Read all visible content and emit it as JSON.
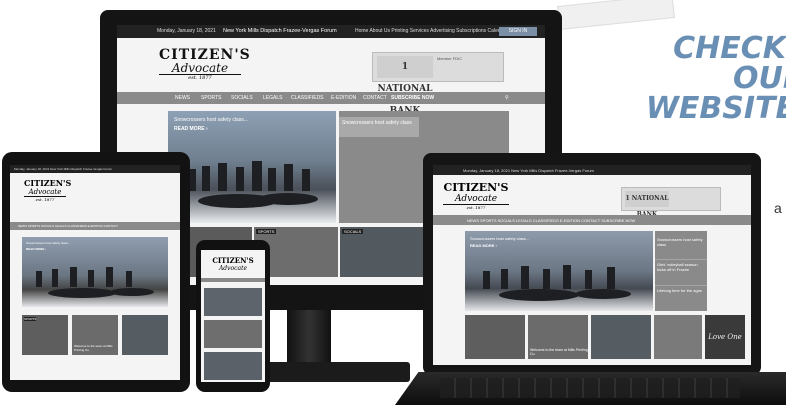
{
  "brand": {
    "line1": "CITIZEN'S",
    "line2": "Advocate",
    "line3": "est. 1877"
  },
  "headline": {
    "line1": "CHECK",
    "line2": "OUR",
    "line3": "WEBSITE"
  },
  "side_text": "a",
  "monitor": {
    "topbar": {
      "date": "Monday, January 18, 2021",
      "links": "New York Mills Dispatch   Frazee-Vergas Forum",
      "menu": "Home   About Us   Printing Services   Advertising   Subscriptions   Calendar   Contact",
      "subscribe": "SIGN IN"
    },
    "ad": {
      "logo": "1 NATIONAL BANK",
      "text": "Member FDIC"
    },
    "nav": [
      "NEWS",
      "SPORTS",
      "SOCIALS",
      "LEGALS",
      "CLASSIFIEDS",
      "E-EDITION",
      "CONTACT",
      "SUBSCRIBE NOW"
    ],
    "hero": {
      "caption": "Snowcrossers host safety class...",
      "more": "READ MORE ›"
    },
    "side_story": "Snowcrossers host safety class",
    "thumbs": [
      {
        "label": "SPORTS"
      },
      {
        "label": "SPORTS"
      },
      {
        "label": "SOCIALS"
      },
      {
        "label": ""
      }
    ]
  },
  "tablet": {
    "topbar": "Monday, January 18, 2021     New York Mills Dispatch   Frazee-Vergas Forum",
    "nav": "NEWS   SPORTS   SOCIALS   LEGALS   CLASSIFIEDS   E-EDITION   CONTACT",
    "hero_caption": "Snowcrossers host safety class...",
    "hero_more": "READ MORE ›",
    "thumb_label": "SPORTS",
    "caption": "Welcome to the team at Mills Printing Co."
  },
  "laptop": {
    "topbar": "Monday, January 18, 2021     New York Mills Dispatch   Frazee-Vergas Forum",
    "nav": "NEWS   SPORTS   SOCIALS   LEGALS   CLASSIFIEDS   E-EDITION   CONTACT   SUBSCRIBE NOW",
    "hero_caption": "Snowcrossers host safety class...",
    "hero_more": "READ MORE ›",
    "side": [
      "Snowcrossers host safety class",
      "Girls' volleyball season kicks off in Frazee",
      "Lifelong time for the ages"
    ],
    "thumb_caption": "Welcome to the team at Mills Printing Co.",
    "card": "Love One"
  },
  "colors": {
    "accent": "#6a8fb4",
    "nav_gray": "#8a8a8a",
    "dark_bezel": "#141414"
  }
}
